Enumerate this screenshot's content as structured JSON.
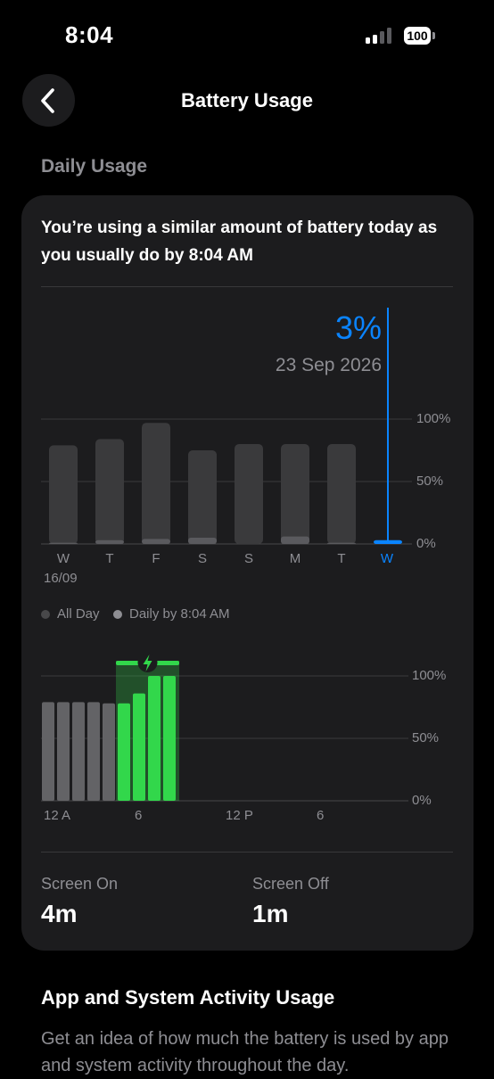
{
  "status_bar": {
    "time": "8:04",
    "battery_level": "100"
  },
  "nav": {
    "title": "Battery Usage",
    "back_icon": "chevron-left-icon"
  },
  "section": {
    "label": "Daily Usage"
  },
  "card": {
    "message": "You’re using a similar amount of battery today as you usually do by 8:04 AM",
    "selected": {
      "value": "3%",
      "date": "23 Sep 2026"
    }
  },
  "colors": {
    "accent": "#0a84ff",
    "charging_green": "#32d74b",
    "bar_gray": "#3a3a3c"
  },
  "daily_chart": {
    "type": "bar",
    "categories": [
      "W",
      "T",
      "F",
      "S",
      "S",
      "M",
      "T",
      "W"
    ],
    "first_date": "16/09",
    "y_ticks": [
      "100%",
      "50%",
      "0%"
    ],
    "ylim": [
      0,
      100
    ],
    "series": [
      {
        "name": "All Day",
        "values": [
          79,
          84,
          97,
          75,
          80,
          80,
          80,
          3
        ]
      },
      {
        "name": "Daily by 8:04 AM",
        "values": [
          1,
          3,
          4,
          5,
          0,
          6,
          1,
          3
        ]
      }
    ],
    "selected_index": 7
  },
  "legend": {
    "all_day": "All Day",
    "daily_by": "Daily by 8:04 AM"
  },
  "hourly_chart": {
    "type": "bar",
    "x_ticks": [
      "12 A",
      "6",
      "12 P",
      "6"
    ],
    "y_ticks": [
      "100%",
      "50%",
      "0%"
    ],
    "ylim": [
      0,
      100
    ],
    "values": [
      79,
      79,
      79,
      79,
      78,
      78,
      86,
      100,
      100
    ],
    "charging": [
      false,
      false,
      false,
      false,
      false,
      true,
      true,
      true,
      true
    ]
  },
  "stats": {
    "screen_on": {
      "label": "Screen On",
      "value": "4m"
    },
    "screen_off": {
      "label": "Screen Off",
      "value": "1m"
    }
  },
  "activity": {
    "title": "App and System Activity Usage",
    "description": "Get an idea of how much the battery is used by app and system activity throughout the day."
  }
}
